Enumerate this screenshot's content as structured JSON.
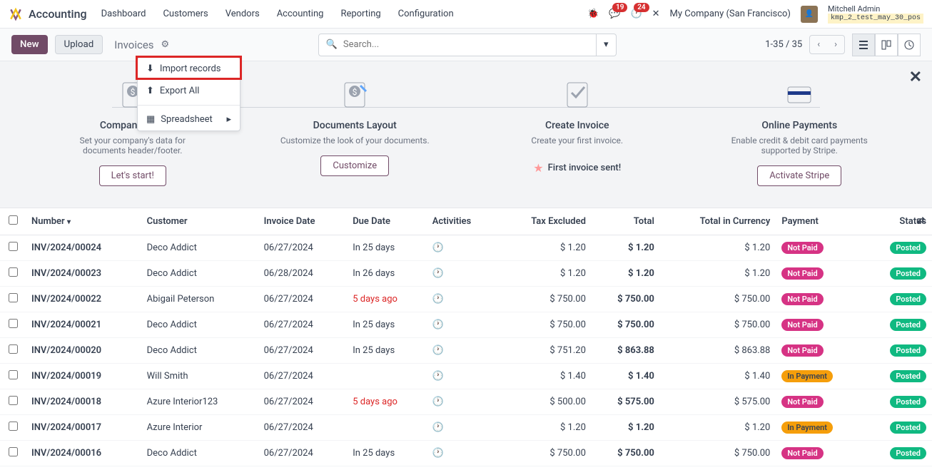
{
  "app_name": "Accounting",
  "nav": [
    "Dashboard",
    "Customers",
    "Vendors",
    "Accounting",
    "Reporting",
    "Configuration"
  ],
  "badges": {
    "chat": "19",
    "clock": "24"
  },
  "company": "My Company (San Francisco)",
  "user": {
    "name": "Mitchell Admin",
    "db": "kmp_2_test_may_30_pos"
  },
  "toolbar": {
    "new": "New",
    "upload": "Upload",
    "breadcrumb": "Invoices"
  },
  "search_placeholder": "Search...",
  "pager": "1-35 / 35",
  "dropdown": {
    "import": "Import records",
    "export": "Export All",
    "spreadsheet": "Spreadsheet"
  },
  "onboard": {
    "steps": [
      {
        "title": "Company Data",
        "desc": "Set your company's data for documents header/footer.",
        "btn": "Let's start!"
      },
      {
        "title": "Documents Layout",
        "desc": "Customize the look of your documents.",
        "btn": "Customize"
      },
      {
        "title": "Create Invoice",
        "desc": "Create your first invoice.",
        "btn": "",
        "sent": "First invoice sent!"
      },
      {
        "title": "Online Payments",
        "desc": "Enable credit & debit card payments supported by Stripe.",
        "btn": "Activate Stripe"
      }
    ]
  },
  "columns": [
    "Number",
    "Customer",
    "Invoice Date",
    "Due Date",
    "Activities",
    "Tax Excluded",
    "Total",
    "Total in Currency",
    "Payment",
    "Status"
  ],
  "rows": [
    {
      "num": "INV/2024/00024",
      "cust": "Deco Addict",
      "date": "06/27/2024",
      "due": "In 25 days",
      "overdue": false,
      "tax": "$ 1.20",
      "total": "$ 1.20",
      "cur": "$ 1.20",
      "pay": "Not Paid",
      "status": "Posted"
    },
    {
      "num": "INV/2024/00023",
      "cust": "Deco Addict",
      "date": "06/28/2024",
      "due": "In 26 days",
      "overdue": false,
      "tax": "$ 1.20",
      "total": "$ 1.20",
      "cur": "$ 1.20",
      "pay": "Not Paid",
      "status": "Posted"
    },
    {
      "num": "INV/2024/00022",
      "cust": "Abigail Peterson",
      "date": "06/27/2024",
      "due": "5 days ago",
      "overdue": true,
      "tax": "$ 750.00",
      "total": "$ 750.00",
      "cur": "$ 750.00",
      "pay": "Not Paid",
      "status": "Posted"
    },
    {
      "num": "INV/2024/00021",
      "cust": "Deco Addict",
      "date": "06/27/2024",
      "due": "In 25 days",
      "overdue": false,
      "tax": "$ 750.00",
      "total": "$ 750.00",
      "cur": "$ 750.00",
      "pay": "Not Paid",
      "status": "Posted"
    },
    {
      "num": "INV/2024/00020",
      "cust": "Deco Addict",
      "date": "06/27/2024",
      "due": "In 25 days",
      "overdue": false,
      "tax": "$ 751.20",
      "total": "$ 863.88",
      "cur": "$ 863.88",
      "pay": "Not Paid",
      "status": "Posted"
    },
    {
      "num": "INV/2024/00019",
      "cust": "Will Smith",
      "date": "06/27/2024",
      "due": "",
      "overdue": false,
      "tax": "$ 1.40",
      "total": "$ 1.40",
      "cur": "$ 1.40",
      "pay": "In Payment",
      "status": "Posted"
    },
    {
      "num": "INV/2024/00018",
      "cust": "Azure Interior123",
      "date": "06/27/2024",
      "due": "5 days ago",
      "overdue": true,
      "tax": "$ 500.00",
      "total": "$ 575.00",
      "cur": "$ 575.00",
      "pay": "Not Paid",
      "status": "Posted"
    },
    {
      "num": "INV/2024/00017",
      "cust": "Azure Interior",
      "date": "06/27/2024",
      "due": "",
      "overdue": false,
      "tax": "$ 1.20",
      "total": "$ 1.20",
      "cur": "$ 1.20",
      "pay": "In Payment",
      "status": "Posted"
    },
    {
      "num": "INV/2024/00016",
      "cust": "Deco Addict",
      "date": "06/27/2024",
      "due": "In 25 days",
      "overdue": false,
      "tax": "$ 750.00",
      "total": "$ 750.00",
      "cur": "$ 750.00",
      "pay": "Not Paid",
      "status": "Posted"
    }
  ]
}
